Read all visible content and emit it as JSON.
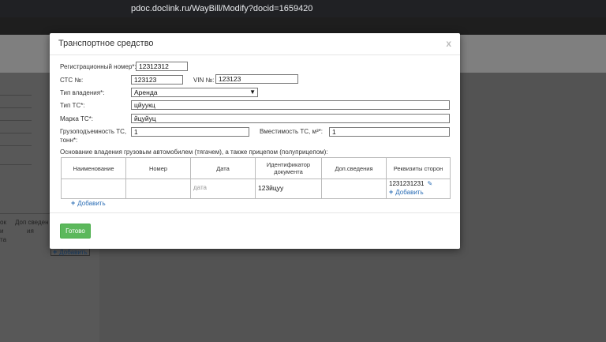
{
  "browser": {
    "url": "pdoc.doclink.ru/WayBill/Modify?docid=1659420"
  },
  "background": {
    "col_header_1": "ок",
    "col_header_2": "Доп сведен",
    "col_header_2b": "ия",
    "col_frag_1": "и",
    "col_frag_2": "та",
    "add_label": "Добавить"
  },
  "modal": {
    "title": "Транспортное средство",
    "close_label": "x",
    "reg_number": {
      "label": "Регистрационный номер*:",
      "value": "12312312"
    },
    "sts": {
      "label": "СТС №:",
      "value": "123123"
    },
    "vin": {
      "label": "VIN №:",
      "value": "123123"
    },
    "ownership_type": {
      "label": "Тип владения*:",
      "value": "Аренда"
    },
    "vehicle_type": {
      "label": "Тип ТС*:",
      "value": "цйуукц"
    },
    "vehicle_brand": {
      "label": "Марка ТС*:",
      "value": "йцуйуц"
    },
    "capacity_tons": {
      "label_1": "Грузоподъемность ТС,",
      "label_2": "тонн*:",
      "value": "1"
    },
    "capacity_m3": {
      "label": "Вместимость ТС, м³*:",
      "value": "1"
    },
    "ownership_basis_label": "Основание владения грузовым автомобилем (тягачем), а также прицепом (полуприцепом):",
    "table": {
      "headers": [
        "Наименование",
        "Номер",
        "Дата",
        "Идентификатор документа",
        "Доп.сведения",
        "Реквизиты сторон"
      ],
      "row": {
        "name": "",
        "number": "",
        "date_placeholder": "дата",
        "doc_id": "123йцуу",
        "extra": "",
        "rekv_value": "1231231231",
        "rekv_add": "Добавить"
      }
    },
    "add_row_label": "Добавить",
    "done_label": "Готово"
  },
  "colors": {
    "accent": "#2a6db5",
    "done_button": "#5cb85c"
  }
}
